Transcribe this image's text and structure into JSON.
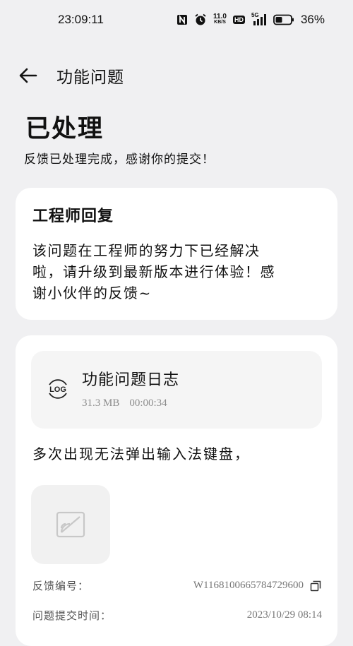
{
  "status_bar": {
    "time": "23:09:11",
    "speed_value": "11.0",
    "speed_unit": "KB/S",
    "hd_label": "HD",
    "network_label": "5G",
    "battery": "36%",
    "icons": [
      "nfc-icon",
      "alarm-icon",
      "network-speed",
      "hd-icon",
      "signal-icon",
      "battery-icon"
    ]
  },
  "nav": {
    "back_icon": "back-arrow-icon",
    "title": "功能问题"
  },
  "status": {
    "heading": "已处理",
    "subtitle": "反馈已处理完成，感谢你的提交！"
  },
  "reply": {
    "title": "工程师回复",
    "lines": [
      "该问题在工程师的努力下已经解决",
      "啦，请升级到最新版本进行体验！感",
      "谢小伙伴的反馈~"
    ]
  },
  "log": {
    "icon_text": "LOG",
    "title": "功能问题日志",
    "size": "31.3 MB",
    "duration": "00:00:34"
  },
  "feedback": {
    "description": "多次出现无法弹出输入法键盘，",
    "image_placeholder_icon": "image-placeholder-icon",
    "id_label": "反馈编号：",
    "id_value": "W1168100665784729600",
    "copy_icon": "copy-icon",
    "submit_label": "问题提交时间：",
    "submit_value": "2023/10/29 08:14"
  }
}
